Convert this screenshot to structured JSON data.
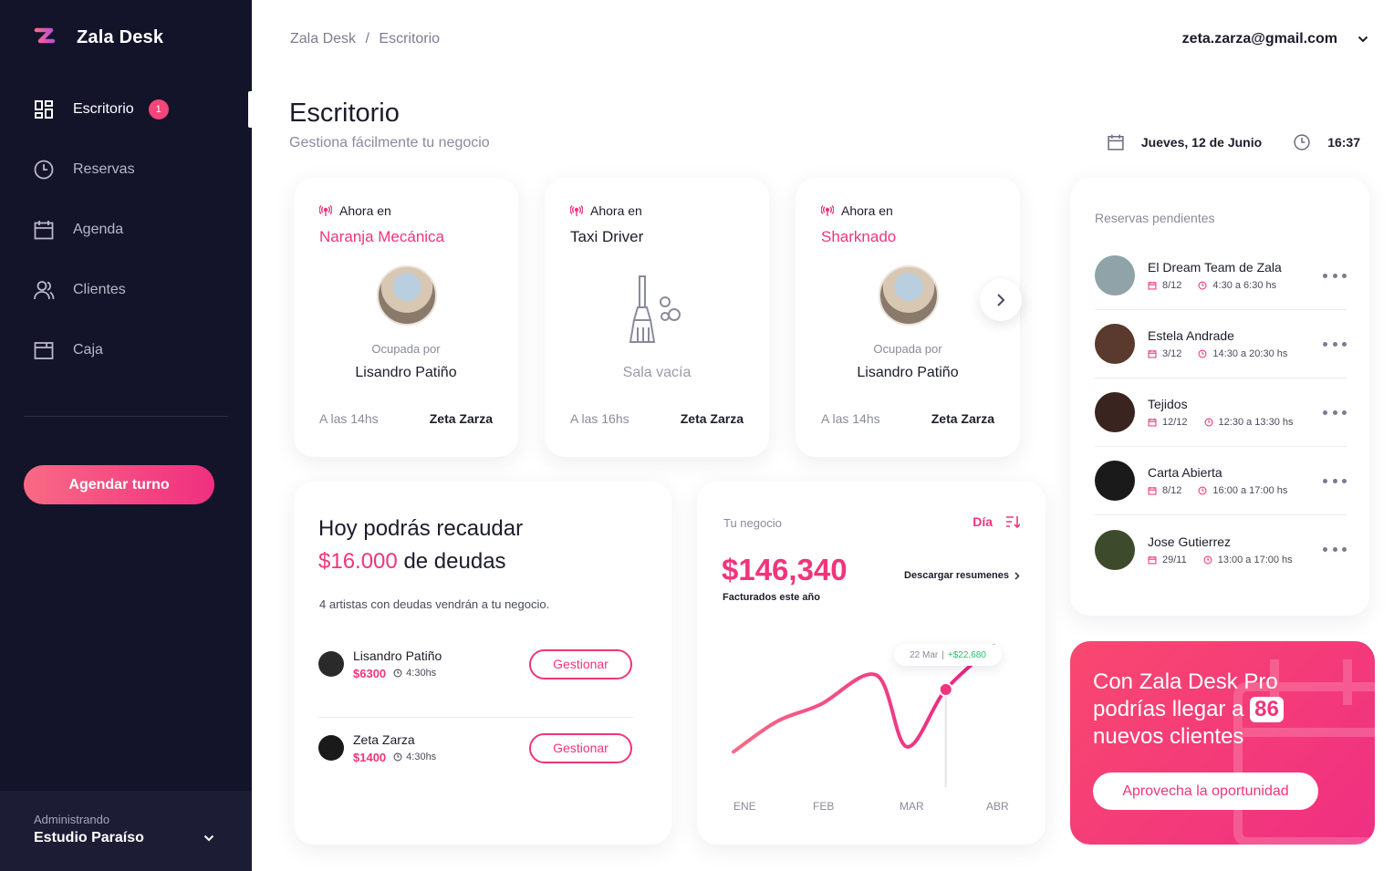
{
  "app": {
    "name": "Zala Desk"
  },
  "sidebar": {
    "items": [
      {
        "label": "Escritorio",
        "icon": "dashboard-icon",
        "badge": "1",
        "active": true
      },
      {
        "label": "Reservas",
        "icon": "clock-icon"
      },
      {
        "label": "Agenda",
        "icon": "calendar-icon"
      },
      {
        "label": "Clientes",
        "icon": "users-icon"
      },
      {
        "label": "Caja",
        "icon": "wallet-icon"
      }
    ],
    "cta": "Agendar turno",
    "footer": {
      "label": "Administrando",
      "value": "Estudio Paraíso"
    }
  },
  "header": {
    "breadcrumb": {
      "root": "Zala Desk",
      "separator": "/",
      "current": "Escritorio"
    },
    "user_email": "zeta.zarza@gmail.com",
    "title": "Escritorio",
    "subtitle": "Gestiona fácilmente tu negocio",
    "date": "Jueves, 12 de Junio",
    "time": "16:37"
  },
  "rooms": [
    {
      "now_label": "Ahora en",
      "name": "Naranja Mecánica",
      "highlight": true,
      "busy_label": "Ocupada por",
      "occupant": "Lisandro Patiño",
      "time": "A las 14hs",
      "owner": "Zeta Zarza"
    },
    {
      "now_label": "Ahora en",
      "name": "Taxi Driver",
      "highlight": false,
      "empty_label": "Sala vacía",
      "time": "A las 16hs",
      "owner": "Zeta Zarza"
    },
    {
      "now_label": "Ahora en",
      "name": "Sharknado",
      "highlight": true,
      "busy_label": "Ocupada por",
      "occupant": "Lisandro Patiño",
      "time": "A las 14hs",
      "owner": "Zeta Zarza"
    }
  ],
  "pending": {
    "title": "Reservas pendientes",
    "items": [
      {
        "name": "El Dream Team de Zala",
        "date": "8/12",
        "time": "4:30 a 6:30 hs",
        "avatar_color": "#8fa3a8"
      },
      {
        "name": "Estela Andrade",
        "date": "3/12",
        "time": "14:30 a 20:30 hs",
        "avatar_color": "#5a3a2e"
      },
      {
        "name": "Tejidos",
        "date": "12/12",
        "time": "12:30 a 13:30 hs",
        "avatar_color": "#3a2420"
      },
      {
        "name": "Carta Abierta",
        "date": "8/12",
        "time": "16:00 a 17:00 hs",
        "avatar_color": "#1a1a1a"
      },
      {
        "name": "Jose Gutierrez",
        "date": "29/11",
        "time": "13:00 a 17:00 hs",
        "avatar_color": "#3d4a2c"
      }
    ]
  },
  "debts": {
    "line1": "Hoy podrás recaudar",
    "amount": "$16.000",
    "line2_suffix": "de deudas",
    "description": "4 artistas con deudas vendrán a tu negocio.",
    "rows": [
      {
        "name": "Lisandro Patiño",
        "amount": "$6300",
        "time": "4:30hs",
        "action": "Gestionar"
      },
      {
        "name": "Zeta Zarza",
        "amount": "$1400",
        "time": "4:30hs",
        "action": "Gestionar"
      }
    ]
  },
  "business": {
    "label": "Tu negocio",
    "period": "Día",
    "amount": "$146,340",
    "amount_caption": "Facturados este año",
    "download": "Descargar resumenes",
    "tooltip": {
      "date": "22 Mar",
      "delta": "+$22,680"
    },
    "accent": "#f0357c"
  },
  "chart_data": {
    "type": "line",
    "categories": [
      "ENE",
      "FEB",
      "MAR",
      "ABR"
    ],
    "values": [
      4,
      40,
      60,
      95,
      10,
      78,
      130
    ],
    "x": [
      0,
      0.5,
      1.0,
      1.65,
      2.0,
      2.45,
      3.0
    ],
    "highlight_index": 5,
    "grid": false
  },
  "pro": {
    "line1": "Con Zala Desk Pro",
    "line2_prefix": "podrías llegar a",
    "number": "86",
    "line3": "nuevos clientes",
    "button": "Aprovecha la oportunidad"
  }
}
